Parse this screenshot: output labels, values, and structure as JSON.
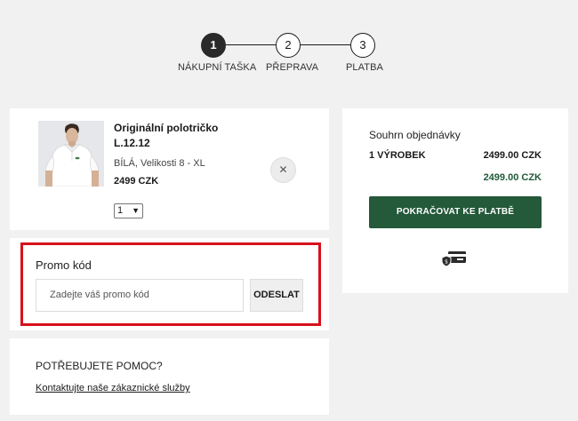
{
  "stepper": {
    "steps": [
      {
        "number": "1",
        "label": "NÁKUPNÍ TAŠKA"
      },
      {
        "number": "2",
        "label": "PŘEPRAVA"
      },
      {
        "number": "3",
        "label": "PLATBA"
      }
    ]
  },
  "cart_item": {
    "name": "Originální polotričko L.12.12",
    "variant": "BÍLÁ, Velikosti 8 - XL",
    "price": "2499 CZK",
    "quantity": "1",
    "remove_icon": "close-icon"
  },
  "promo": {
    "title": "Promo kód",
    "placeholder": "Zadejte váš promo kód",
    "submit_label": "ODESLAT"
  },
  "help": {
    "title": "POTŘEBUJETE POMOC?",
    "link_text": "Kontaktujte naše zákaznické služby"
  },
  "summary": {
    "title": "Souhrn objednávky",
    "item_count": "1 VÝROBEK",
    "items_amount": "2499.00 CZK",
    "total_amount": "2499.00 CZK",
    "continue_label": "POKRAČOVAT KE PLATBĚ",
    "secure_icon": "secure-payment-card-icon"
  },
  "colors": {
    "accent_green": "#24593a",
    "total_green": "#1f5a38",
    "highlight_red": "#d7111b",
    "active_step": "#2a2a2a"
  }
}
